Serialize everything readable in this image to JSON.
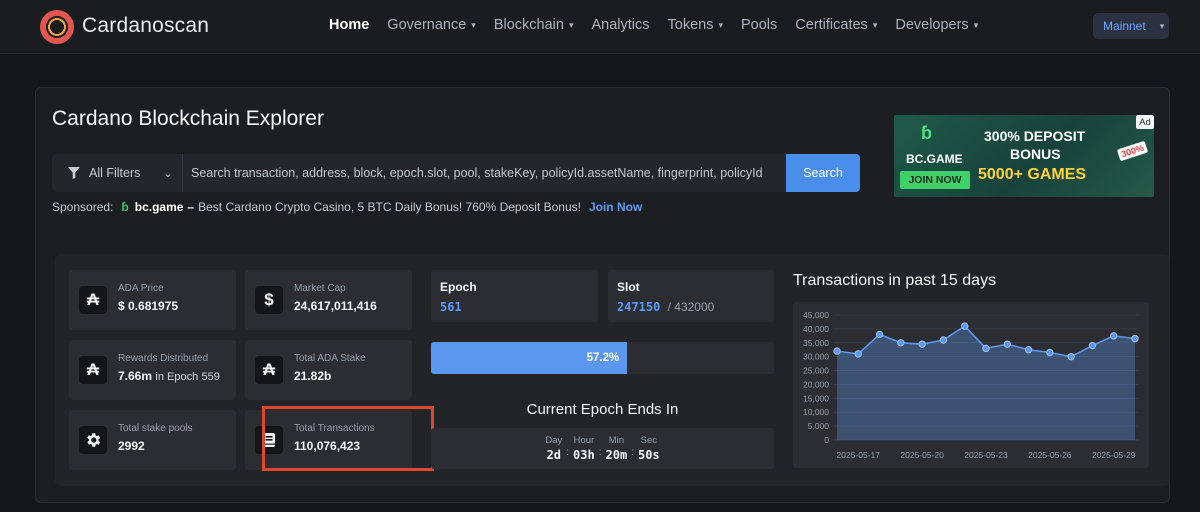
{
  "nav": {
    "brand": "Cardanoscan",
    "items": [
      {
        "label": "Home",
        "dropdown": false,
        "active": true
      },
      {
        "label": "Governance",
        "dropdown": true
      },
      {
        "label": "Blockchain",
        "dropdown": true
      },
      {
        "label": "Analytics",
        "dropdown": false
      },
      {
        "label": "Tokens",
        "dropdown": true
      },
      {
        "label": "Pools",
        "dropdown": false
      },
      {
        "label": "Certificates",
        "dropdown": true
      },
      {
        "label": "Developers",
        "dropdown": true
      }
    ],
    "network": "Mainnet"
  },
  "header": {
    "title": "Cardano Blockchain Explorer"
  },
  "search": {
    "filter_label": "All Filters",
    "placeholder": "Search transaction, address, block, epoch.slot, pool, stakeKey, policyId.assetName, fingerprint, policyId",
    "button_label": "Search"
  },
  "sponsor": {
    "prefix": "Sponsored:",
    "brand": "bc.game",
    "dash": "–",
    "text": "Best Cardano Crypto Casino, 5 BTC Daily Bonus! 760% Deposit Bonus!",
    "link": "Join Now"
  },
  "ad": {
    "tag": "Ad",
    "brand": "BC.GAME",
    "join": "JOIN NOW",
    "line1": "300% DEPOSIT",
    "line2": "BONUS",
    "line3": "5000+ GAMES",
    "badge": "300%"
  },
  "stats": {
    "ada_price": {
      "label": "ADA Price",
      "value": "$ 0.681975"
    },
    "market_cap": {
      "label": "Market Cap",
      "value": "24,617,011,416"
    },
    "rewards": {
      "label": "Rewards Distributed",
      "value": "7.66m",
      "mid": "in Epoch",
      "epoch": "559"
    },
    "total_stake": {
      "label": "Total ADA Stake",
      "value": "21.82b"
    },
    "pools": {
      "label": "Total stake pools",
      "value": "2992"
    },
    "transactions": {
      "label": "Total Transactions",
      "value": "110,076,423"
    }
  },
  "epoch": {
    "label": "Epoch",
    "value": "561",
    "slot_label": "Slot",
    "slot_value": "247150",
    "slot_total": "/ 432000",
    "progress_percent": 57.2,
    "progress_label": "57.2%",
    "ends_title": "Current Epoch Ends In",
    "countdown": [
      {
        "unit": "Day",
        "value": "2d"
      },
      {
        "unit": "Hour",
        "value": "03h"
      },
      {
        "unit": "Min",
        "value": "20m"
      },
      {
        "unit": "Sec",
        "value": "50s"
      }
    ],
    "separator": ":"
  },
  "chart_data": {
    "type": "area",
    "title": "Transactions in past 15 days",
    "x": [
      "2025-05-16",
      "2025-05-17",
      "2025-05-18",
      "2025-05-19",
      "2025-05-20",
      "2025-05-21",
      "2025-05-22",
      "2025-05-23",
      "2025-05-24",
      "2025-05-25",
      "2025-05-26",
      "2025-05-27",
      "2025-05-28",
      "2025-05-29",
      "2025-05-30"
    ],
    "x_tick_labels": [
      "2025-05-17",
      "2025-05-20",
      "2025-05-23",
      "2025-05-26",
      "2025-05-29"
    ],
    "values": [
      32000,
      31000,
      38000,
      35000,
      34500,
      36000,
      41000,
      33000,
      34500,
      32500,
      31500,
      30000,
      34000,
      37500,
      36500
    ],
    "yticks": [
      "0",
      "5,000",
      "10,000",
      "15,000",
      "20,000",
      "25,000",
      "30,000",
      "35,000",
      "40,000",
      "45,000"
    ],
    "ylim": [
      0,
      45000
    ],
    "grid": true,
    "color": "#5b97ee"
  }
}
